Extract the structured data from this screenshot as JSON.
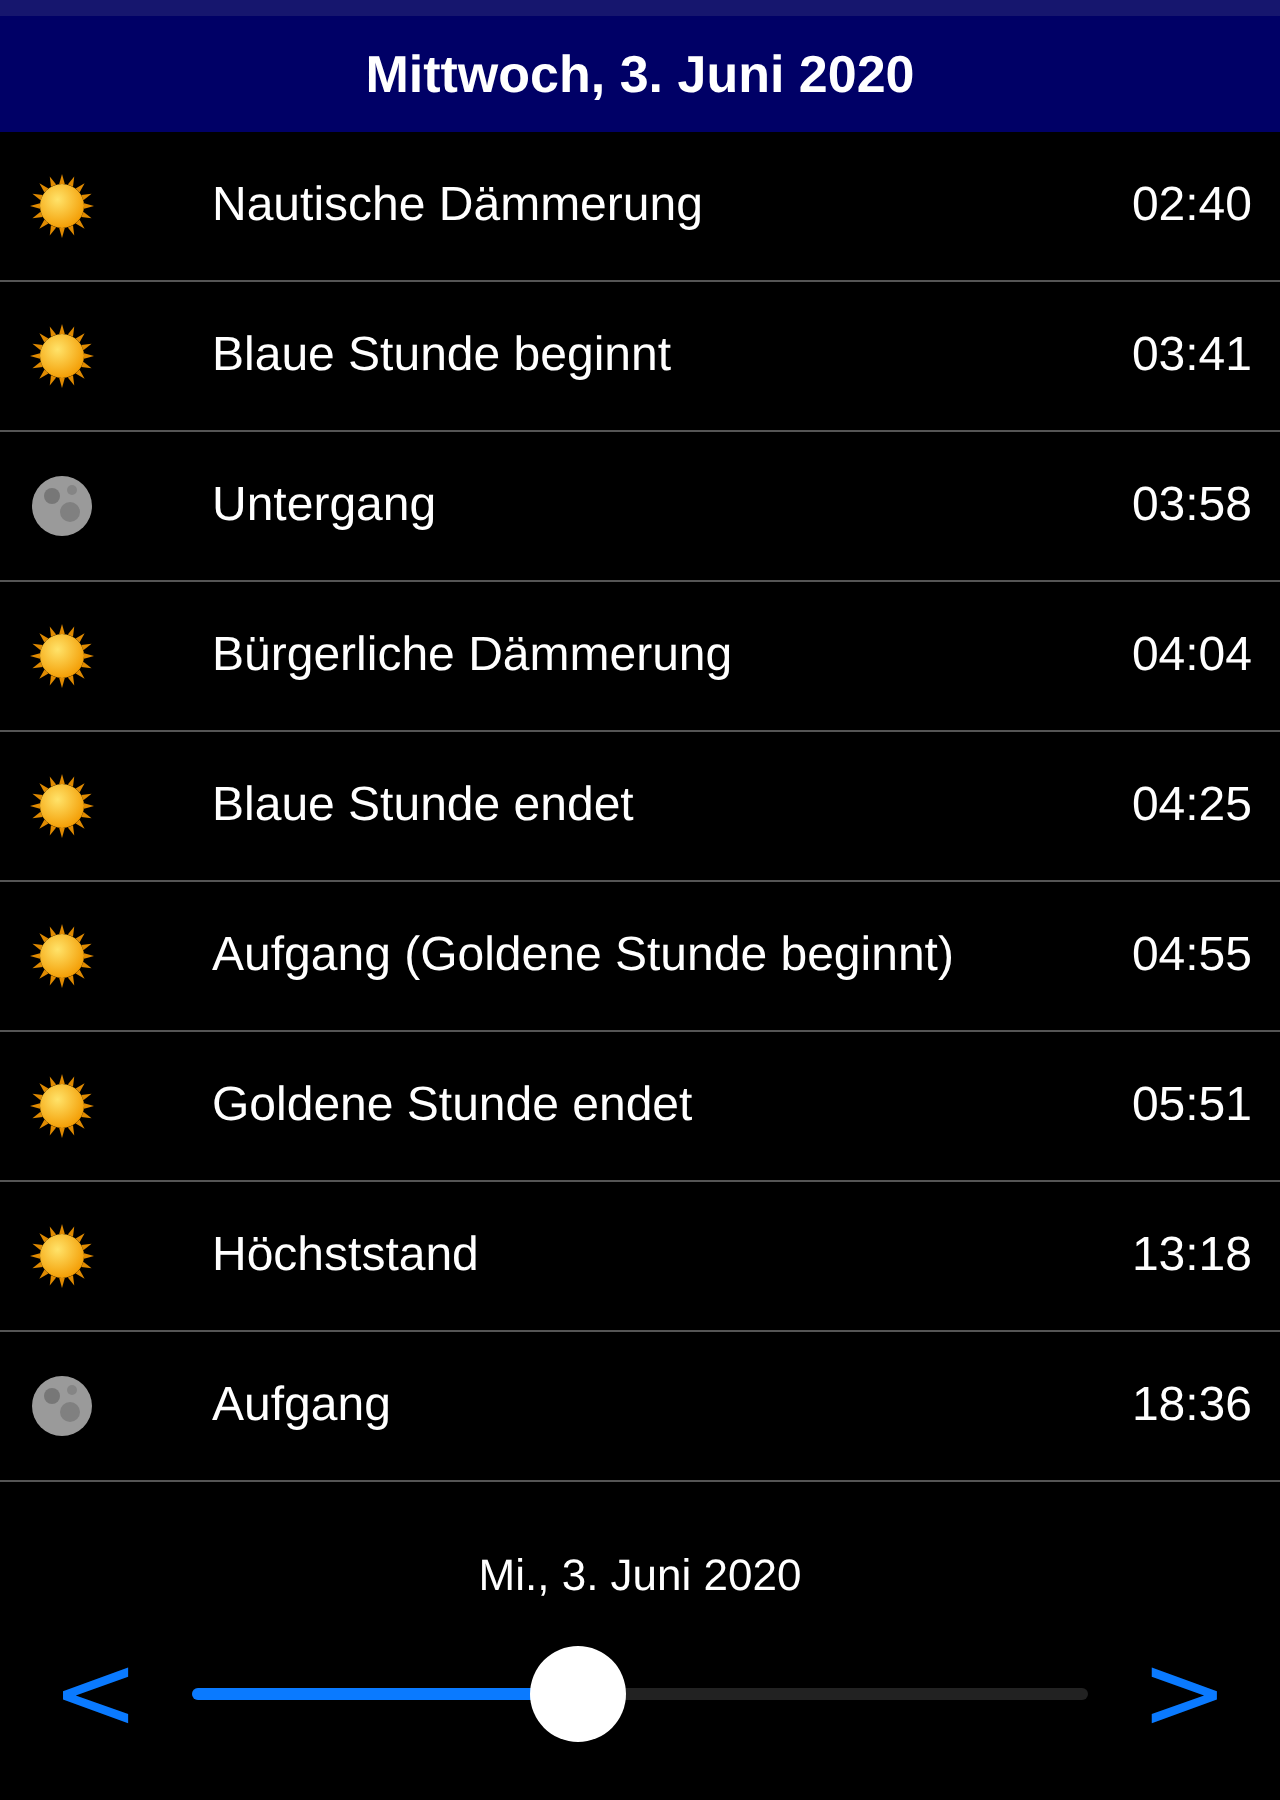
{
  "header": {
    "title": "Mittwoch, 3. Juni 2020"
  },
  "events": [
    {
      "kind": "sun",
      "label": "Nautische Dämmerung",
      "time": "02:40"
    },
    {
      "kind": "sun",
      "label": "Blaue Stunde beginnt",
      "time": "03:41"
    },
    {
      "kind": "moon",
      "label": "Untergang",
      "time": "03:58"
    },
    {
      "kind": "sun",
      "label": "Bürgerliche Dämmerung",
      "time": "04:04"
    },
    {
      "kind": "sun",
      "label": "Blaue Stunde endet",
      "time": "04:25"
    },
    {
      "kind": "sun",
      "label": "Aufgang (Goldene Stunde beginnt)",
      "time": "04:55"
    },
    {
      "kind": "sun",
      "label": "Goldene Stunde endet",
      "time": "05:51"
    },
    {
      "kind": "sun",
      "label": "Höchststand",
      "time": "13:18"
    },
    {
      "kind": "moon",
      "label": "Aufgang",
      "time": "18:36"
    }
  ],
  "footer": {
    "date": "Mi., 3. Juni 2020",
    "prev": "<",
    "next": ">",
    "slider": {
      "level": 0.43
    }
  }
}
